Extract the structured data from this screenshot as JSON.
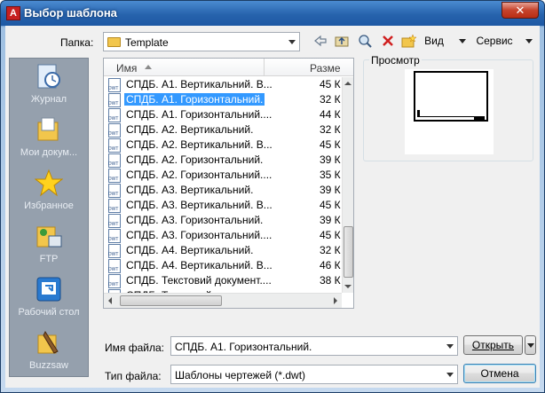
{
  "window": {
    "title": "Выбор шаблона",
    "close_glyph": "✕"
  },
  "folder": {
    "label": "Папка:",
    "value": "Template"
  },
  "toolbar": {
    "view_label": "Вид",
    "tools_label": "Сервис"
  },
  "places": [
    "Журнал",
    "Мои докум...",
    "Избранное",
    "FTP",
    "Рабочий стол",
    "Buzzsaw"
  ],
  "file_list": {
    "columns": [
      "Имя",
      "Разме"
    ],
    "rows": [
      {
        "name": "СПДБ. А1. Вертикальний. В...",
        "size": "45 К",
        "selected": false
      },
      {
        "name": "СПДБ. А1. Горизонтальний.",
        "size": "32 К",
        "selected": true
      },
      {
        "name": "СПДБ. А1. Горизонтальний....",
        "size": "44 К",
        "selected": false
      },
      {
        "name": "СПДБ. А2. Вертикальний.",
        "size": "32 К",
        "selected": false
      },
      {
        "name": "СПДБ. А2. Вертикальний. В...",
        "size": "45 К",
        "selected": false
      },
      {
        "name": "СПДБ. А2. Горизонтальний.",
        "size": "39 К",
        "selected": false
      },
      {
        "name": "СПДБ. А2. Горизонтальний....",
        "size": "35 К",
        "selected": false
      },
      {
        "name": "СПДБ. А3. Вертикальний.",
        "size": "39 К",
        "selected": false
      },
      {
        "name": "СПДБ. А3. Вертикальний. В...",
        "size": "45 К",
        "selected": false
      },
      {
        "name": "СПДБ. А3. Горизонтальний.",
        "size": "39 К",
        "selected": false
      },
      {
        "name": "СПДБ. А3. Горизонтальний....",
        "size": "45 К",
        "selected": false
      },
      {
        "name": "СПДБ. А4. Вертикальний.",
        "size": "32 К",
        "selected": false
      },
      {
        "name": "СПДБ. А4. Вертикальний. В...",
        "size": "46 К",
        "selected": false
      },
      {
        "name": "СПДБ. Текстовий документ....",
        "size": "38 К",
        "selected": false
      },
      {
        "name": "СПДБ. Текстовий документ....",
        "size": "",
        "selected": false
      }
    ]
  },
  "preview": {
    "label": "Просмотр"
  },
  "filename": {
    "label": "Имя файла:",
    "value": "СПДБ. А1. Горизонтальний."
  },
  "filetype": {
    "label": "Тип файла:",
    "value": "Шаблоны чертежей (*.dwt)"
  },
  "buttons": {
    "open_label": "Открыть",
    "cancel_label": "Отмена"
  }
}
